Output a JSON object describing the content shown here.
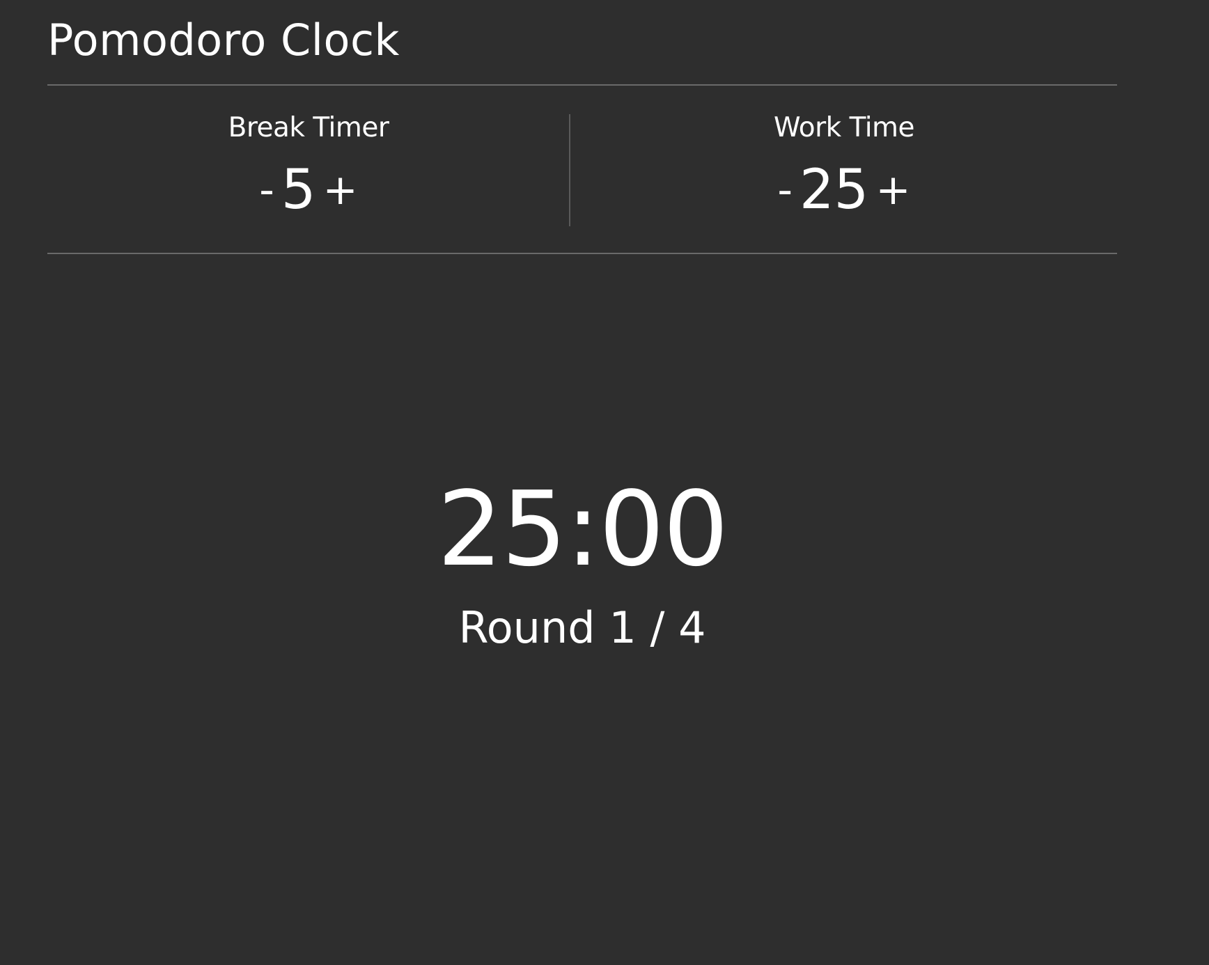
{
  "app": {
    "title": "Pomodoro Clock"
  },
  "break_timer": {
    "label": "Break Timer",
    "decrement_label": "-",
    "value": "5",
    "increment_label": "+"
  },
  "work_time": {
    "label": "Work Time",
    "decrement_label": "-",
    "value": "25",
    "increment_label": "+"
  },
  "timer": {
    "display": "25:00",
    "round": "Round 1 / 4"
  },
  "colors": {
    "background": "#2e2e2e",
    "text": "#ffffff",
    "divider": "#6a6a6a"
  }
}
